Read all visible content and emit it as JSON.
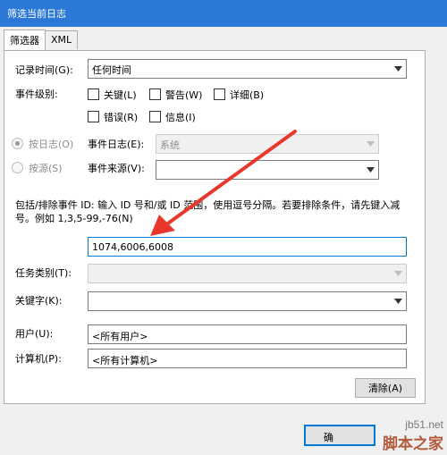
{
  "window": {
    "title": "筛选当前日志"
  },
  "tabs": [
    {
      "label": "筛选器",
      "active": true
    },
    {
      "label": "XML",
      "active": false
    }
  ],
  "filter": {
    "logged_label": "记录时间(G):",
    "logged_value": "任何时间",
    "event_level_label": "事件级别:",
    "levels": [
      {
        "label": "关键(L)",
        "checked": false
      },
      {
        "label": "警告(W)",
        "checked": false
      },
      {
        "label": "详细(B)",
        "checked": false
      },
      {
        "label": "错误(R)",
        "checked": false
      },
      {
        "label": "信息(I)",
        "checked": false
      }
    ],
    "by_log_label": "按日志(O)",
    "by_source_label": "按源(S)",
    "event_log_label": "事件日志(E):",
    "event_log_value": "系统",
    "event_source_label": "事件来源(V):",
    "event_source_value": "",
    "description": "包括/排除事件 ID: 输入 ID 号和/或 ID 范围，使用逗号分隔。若要排除条件，请先键入减号。例如 1,3,5-99,-76(N)",
    "event_ids_value": "1074,6006,6008",
    "task_category_label": "任务类别(T):",
    "task_category_value": "",
    "keywords_label": "关键字(K):",
    "keywords_value": "",
    "user_label": "用户(U):",
    "user_value": "<所有用户>",
    "computer_label": "计算机(P):",
    "computer_value": "<所有计算机>",
    "clear_label": "清除(A)"
  },
  "footer": {
    "ok_label": "确"
  },
  "watermark": {
    "url": "jb51.net",
    "name": "脚本之家"
  },
  "colors": {
    "titlebar": "#2b78d6",
    "annotation_arrow": "#e8382e",
    "focus_border": "#0078d7"
  }
}
